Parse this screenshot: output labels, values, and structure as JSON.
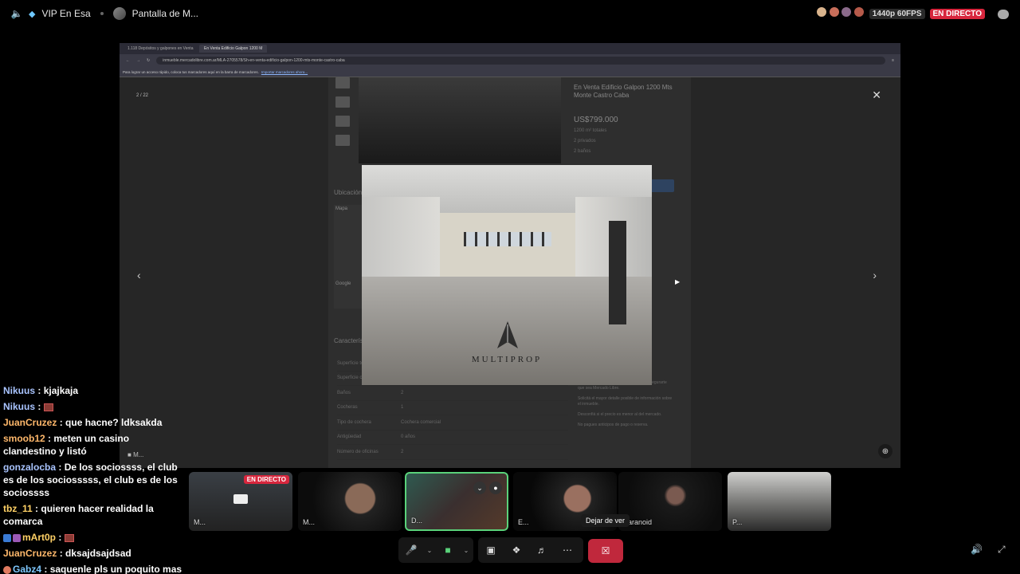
{
  "topbar": {
    "channel_name": "VIP En Esa",
    "screen_name": "Pantalla de M...",
    "quality": "1440p 60FPS",
    "live_label": "EN DIRECTO"
  },
  "browser": {
    "tabs": [
      {
        "label": "1.118 Depósitos y galpones en Venta"
      },
      {
        "label": "En Venta Edificio Galpon 1200 M"
      }
    ],
    "url": "inmueble.mercadolibre.com.ar/MLA-2705578/Sh-en-venta-edificio-galpon-1200-mts-monte-castro-caba",
    "bookmarks_hint": "Para lograr un acceso rápido, coloca tus marcadores aquí en la barra de marcadores.",
    "bookmarks_link": "Importar marcadores ahora..."
  },
  "lightbox": {
    "counter": "2 / 22",
    "photo_brand": "MULTIPROP",
    "listing_title": "En Venta Edificio Galpon 1200 Mts Monte Castro Caba",
    "price": "US$799.000",
    "features": [
      "1200 m² totales",
      "2 privados",
      "2 baños"
    ],
    "location_heading": "Ubicación",
    "map_tab": "Mapa",
    "google_label": "Google",
    "characteristics_heading": "Características",
    "table_rows": [
      {
        "k": "Superficie total",
        "v": ""
      },
      {
        "k": "Superficie cubierta",
        "v": ""
      },
      {
        "k": "Baños",
        "v": "2"
      },
      {
        "k": "Cocheras",
        "v": "1"
      },
      {
        "k": "Tipo de cochera",
        "v": "Cochera comercial"
      },
      {
        "k": "Antigüedad",
        "v": "0 años"
      },
      {
        "k": "Número de oficinas",
        "v": "2"
      }
    ],
    "bullets": [
      "Revisá el vendedor de los precios para asegurarte que sea Mercado Libre.",
      "Solicitá el mayor detalle posible de información sobre el inmueble.",
      "Desconfiá si el precio es menor al del mercado.",
      "No pagues anticipos de pago o reserva."
    ],
    "minimized_label": "M..."
  },
  "participants": [
    {
      "name": "M...",
      "live": "EN DIRECTO"
    },
    {
      "name": "M..."
    },
    {
      "name": "D..."
    },
    {
      "name": "E..."
    },
    {
      "name": "aranoid"
    },
    {
      "name": "P..."
    }
  ],
  "tooltip": "Dejar de ver",
  "chat": [
    {
      "user": "Nikuus",
      "color": "#a9c4ff",
      "text": "kjajkaja"
    },
    {
      "user": "Nikuus",
      "color": "#a9c4ff",
      "text": "",
      "emote": true
    },
    {
      "user": "JuanCruzez",
      "color": "#ffb86b",
      "text": "que hacne? ldksakda"
    },
    {
      "user": "smoob12",
      "color": "#ffb86b",
      "text": "meten un casino clandestino y listó"
    },
    {
      "user": "gonzalocba",
      "color": "#a9c4ff",
      "text": "De los sociossss, el club es de los sociosssss, el club es de los sociossss"
    },
    {
      "user": "tbz_11",
      "color": "#ffd166",
      "text": "quieren hacer realidad la comarca"
    },
    {
      "user": "mArt0p",
      "color": "#ffd166",
      "text": "",
      "emote": true
    },
    {
      "user": "JuanCruzez",
      "color": "#ffb86b",
      "text": "dksajdsajdsad"
    },
    {
      "user": "Gabz4",
      "color": "#7ec8ff",
      "text": "saquenle pls un poquito mas de zoom para los q no somos de bs as"
    }
  ]
}
